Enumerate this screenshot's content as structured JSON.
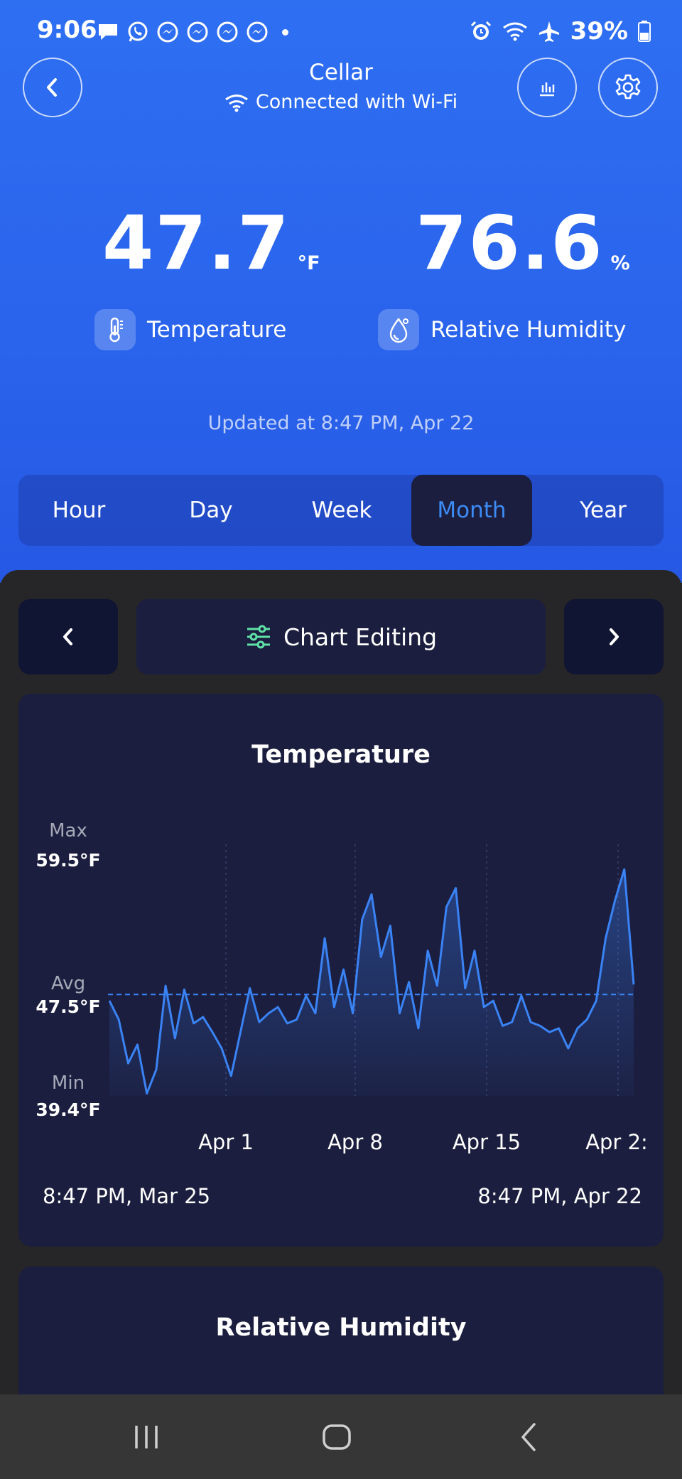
{
  "status_bar": {
    "time": "9:06",
    "battery": "39%",
    "left_icons": [
      "chat-bubble-icon",
      "whatsapp-icon",
      "messenger-icon",
      "messenger-icon",
      "messenger-icon",
      "messenger-icon"
    ],
    "right_icons": [
      "alarm-icon",
      "wifi-icon",
      "airplane-icon",
      "battery-icon"
    ]
  },
  "header": {
    "title": "Cellar",
    "connection": "Connected with Wi-Fi"
  },
  "readings": {
    "temperature": {
      "value": "47.7",
      "unit": "°F",
      "label": "Temperature"
    },
    "humidity": {
      "value": "76.6",
      "unit": "%",
      "label": "Relative Humidity"
    }
  },
  "updated": "Updated at 8:47 PM, Apr 22",
  "tabs": [
    {
      "label": "Hour"
    },
    {
      "label": "Day"
    },
    {
      "label": "Week"
    },
    {
      "label": "Month",
      "active": true
    },
    {
      "label": "Year"
    }
  ],
  "chart_editing": {
    "label": "Chart Editing"
  },
  "chart_data": {
    "type": "area",
    "title": "Temperature",
    "x_ticks": [
      "Apr 1",
      "Apr 8",
      "Apr 15",
      "Apr 2:"
    ],
    "range_start": "8:47 PM, Mar 25",
    "range_end": "8:47 PM, Apr 22",
    "max": {
      "label": "Max",
      "value": "59.5°F"
    },
    "avg": {
      "label": "Avg",
      "value": "47.5°F"
    },
    "min": {
      "label": "Min",
      "value": "39.4°F"
    },
    "ylim": [
      39.4,
      59.5
    ],
    "average_value": 47.5,
    "series": [
      {
        "x": [
          0,
          0.5,
          1,
          1.5,
          2,
          2.5,
          3,
          3.5,
          4,
          4.5,
          5,
          5.5,
          6,
          6.5,
          7,
          7.5,
          8,
          8.5,
          9,
          9.5,
          10,
          10.5,
          11,
          11.5,
          12,
          12.5,
          13,
          13.5,
          14,
          14.5,
          15,
          15.5,
          16,
          16.5,
          17,
          17.5,
          18,
          18.5,
          19,
          19.5,
          20,
          20.5,
          21,
          21.5,
          22,
          22.5,
          23,
          23.5,
          24,
          24.5,
          25,
          25.5,
          26,
          26.5,
          27,
          27.5,
          28
        ],
        "values": [
          47.0,
          45.5,
          42.0,
          43.5,
          39.6,
          41.5,
          48.2,
          44.0,
          47.9,
          45.2,
          45.7,
          44.5,
          43.2,
          41.0,
          44.5,
          48.0,
          45.3,
          46.0,
          46.5,
          45.2,
          45.5,
          47.4,
          46.0,
          52.0,
          46.5,
          49.5,
          46.0,
          53.5,
          55.5,
          50.5,
          53.0,
          46.0,
          48.5,
          44.8,
          51.0,
          48.2,
          54.5,
          56.0,
          48.0,
          51.0,
          46.5,
          47.0,
          45.0,
          45.3,
          47.4,
          45.3,
          45.0,
          44.5,
          44.8,
          43.2,
          44.8,
          45.5,
          47.0,
          52.0,
          55.0,
          57.5,
          48.3
        ]
      }
    ]
  },
  "humidity_card": {
    "title": "Relative Humidity"
  },
  "system_nav": [
    "recent-apps-icon",
    "home-icon",
    "back-icon"
  ]
}
